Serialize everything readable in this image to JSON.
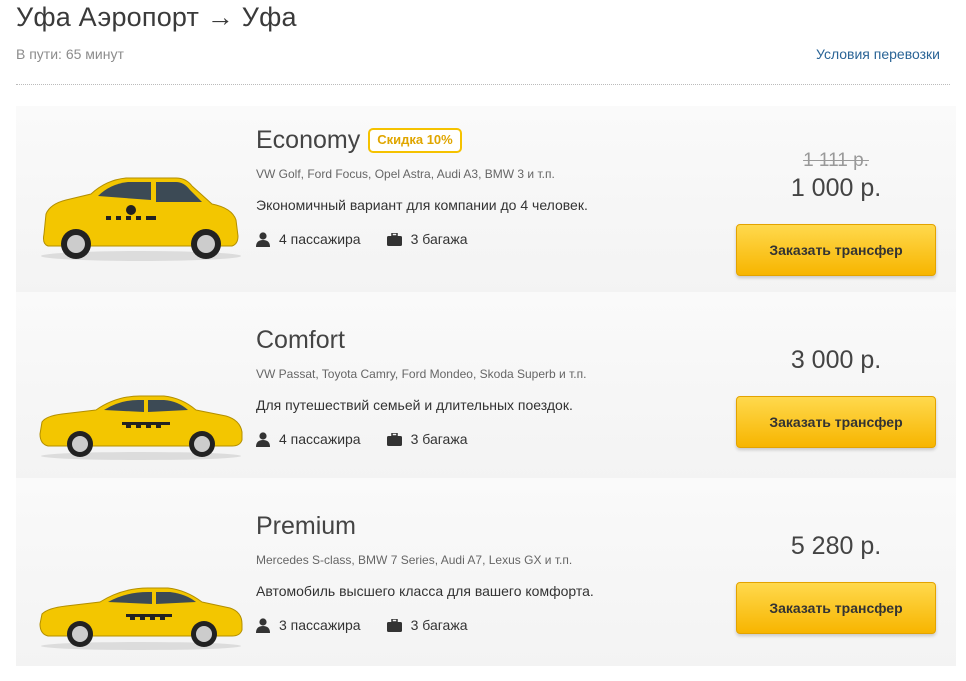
{
  "header": {
    "route_title": "Уфа Аэропорт → Уфа",
    "trip_time": "В пути: 65 минут",
    "terms_link": "Условия перевозки"
  },
  "offers": [
    {
      "class_name": "Economy",
      "discount_badge": "Скидка 10%",
      "models": "VW Golf, Ford Focus, Opel Astra, Audi A3, BMW 3 и т.п.",
      "description": "Экономичный вариант для компании до 4 человек.",
      "passengers": "4 пассажира",
      "luggage": "3 багажа",
      "old_price": "1 111 р.",
      "price": "1 000 р.",
      "button": "Заказать трансфер",
      "car_icon": "hatchback-taxi-icon"
    },
    {
      "class_name": "Comfort",
      "models": "VW Passat, Toyota Camry, Ford Mondeo, Skoda Superb и т.п.",
      "description": "Для путешествий семьей и длительных поездок.",
      "passengers": "4 пассажира",
      "luggage": "3 багажа",
      "price": "3 000 р.",
      "button": "Заказать трансфер",
      "car_icon": "sedan-taxi-icon"
    },
    {
      "class_name": "Premium",
      "models": "Mercedes S-class, BMW 7 Series, Audi A7, Lexus GX и т.п.",
      "description": "Автомобиль высшего класса для вашего комфорта.",
      "passengers": "3 пассажира",
      "luggage": "3 багажа",
      "price": "5 280 р.",
      "button": "Заказать трансфер",
      "car_icon": "premium-taxi-icon"
    }
  ],
  "colors": {
    "accent": "#f7b500",
    "link": "#2a6496",
    "car_yellow": "#f3c600"
  }
}
